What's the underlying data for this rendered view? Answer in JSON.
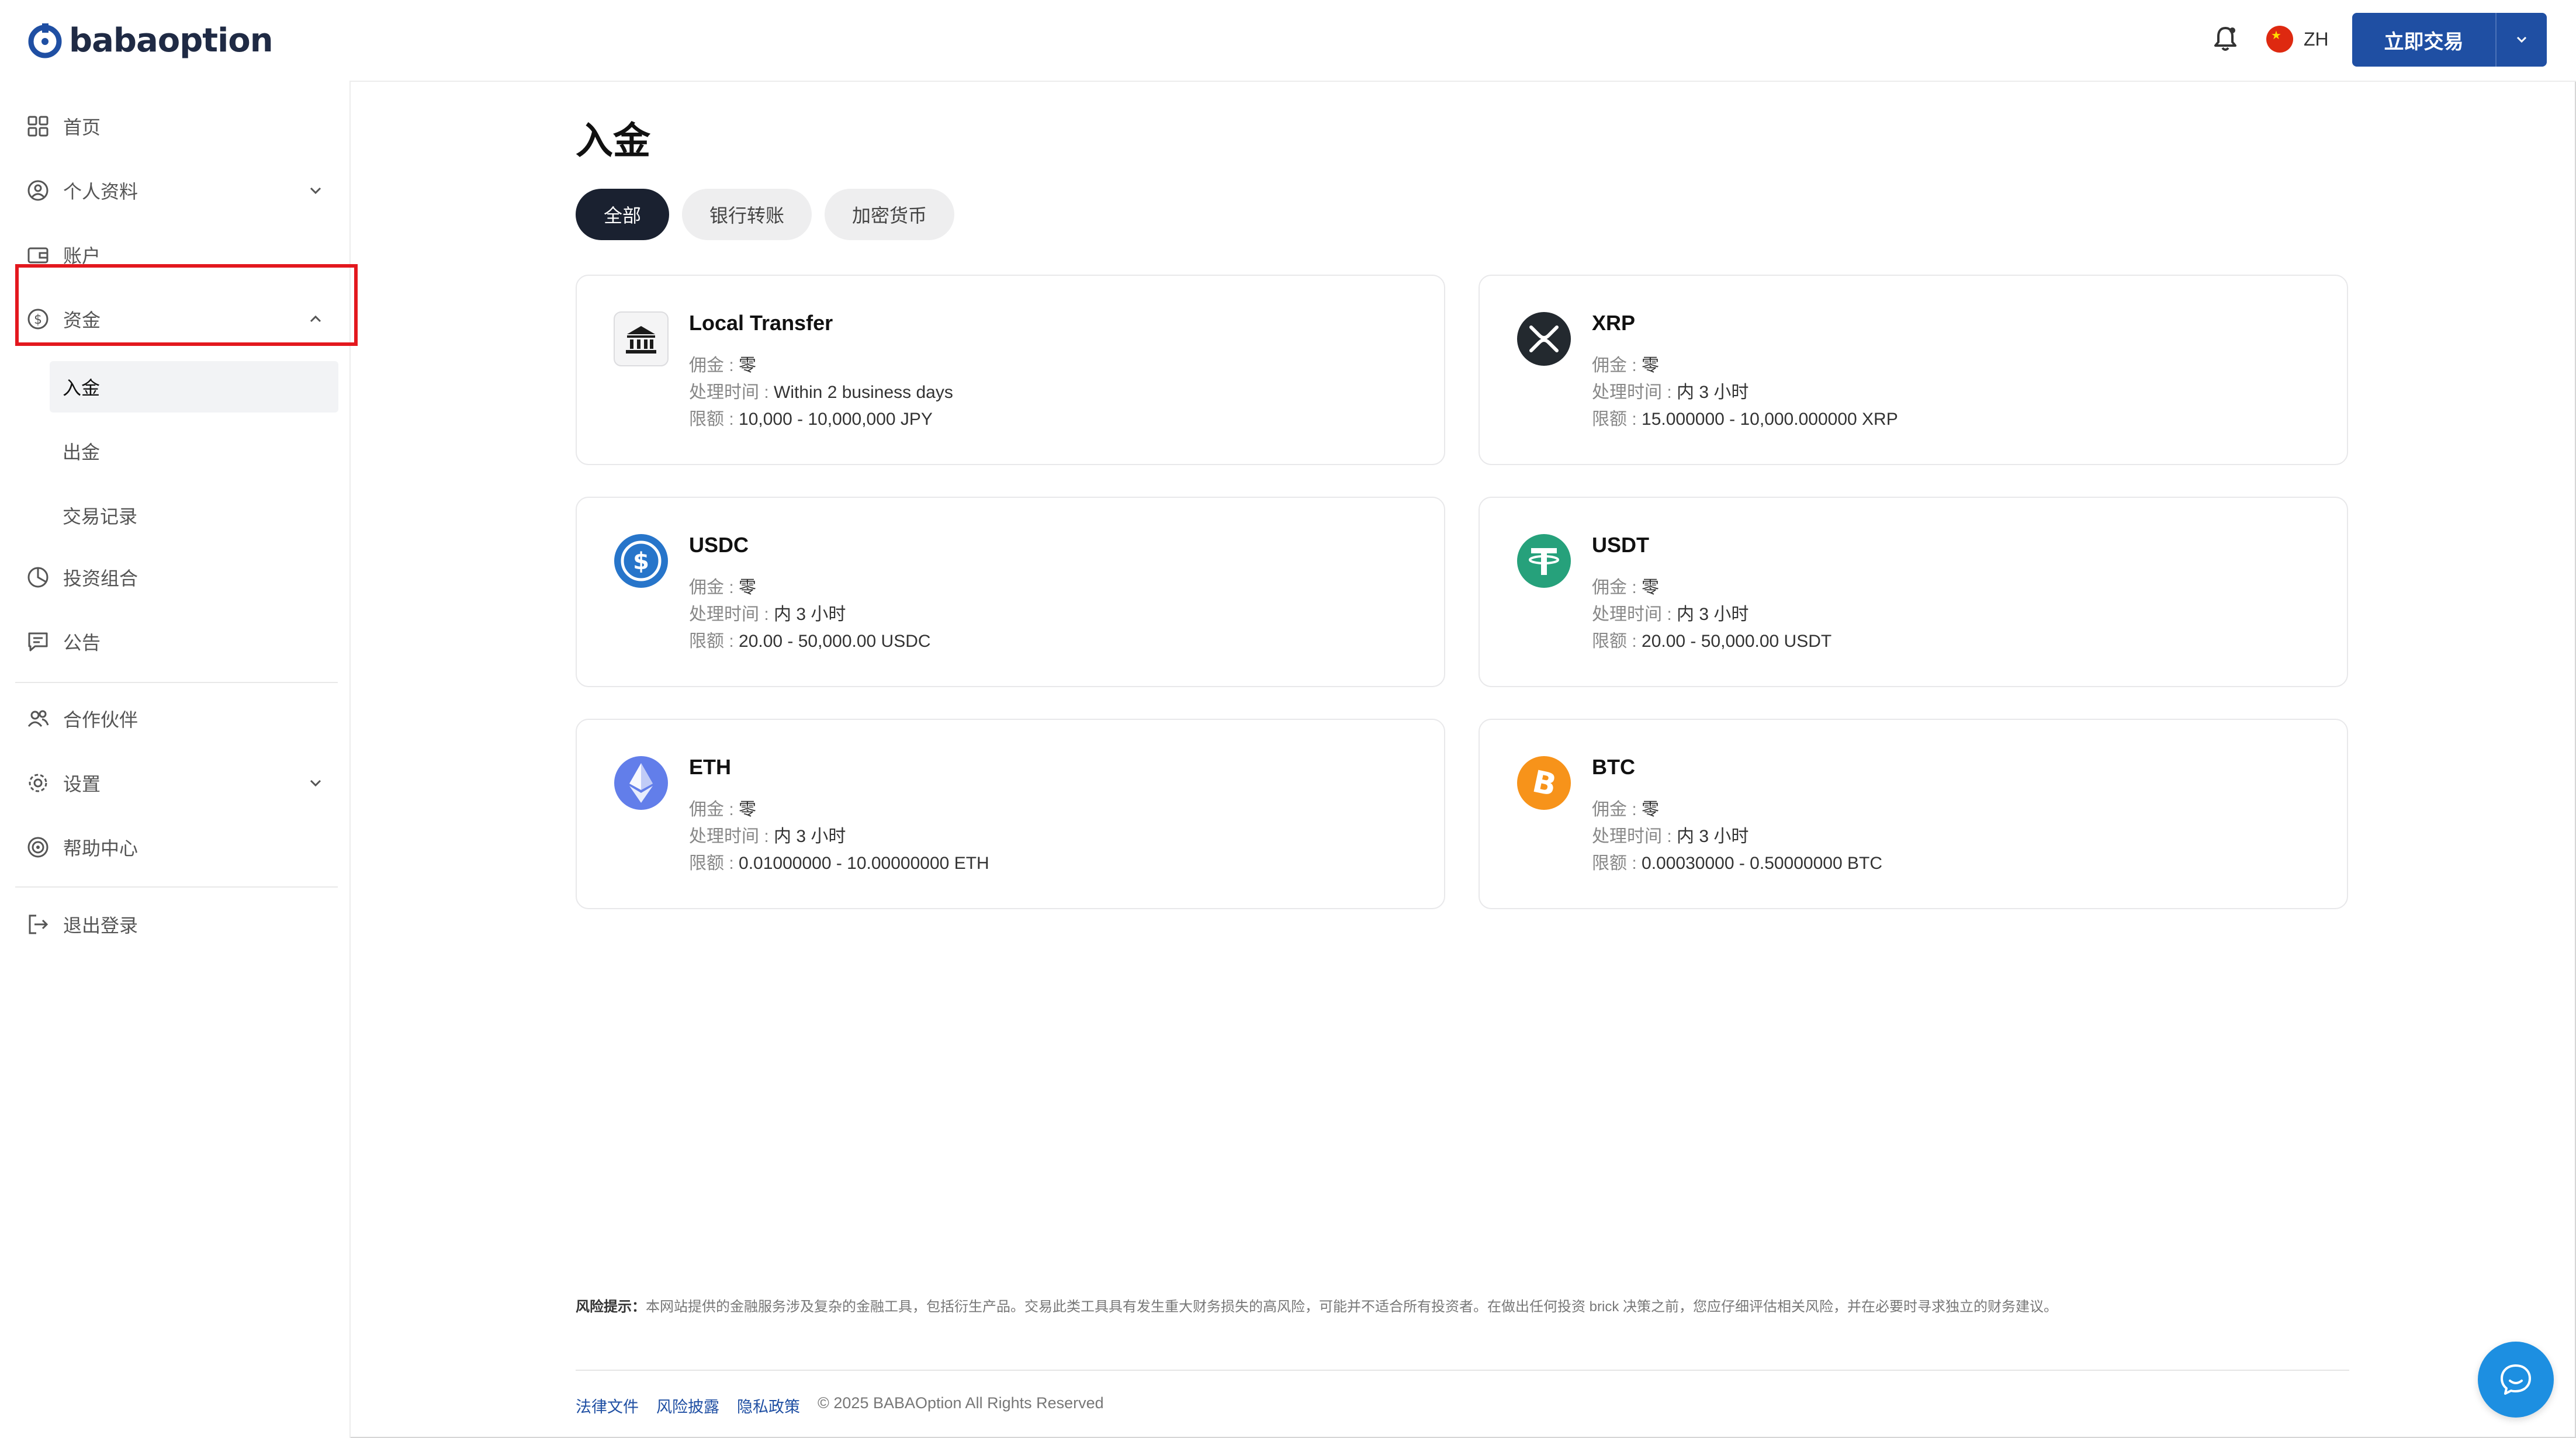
{
  "header": {
    "logo_text": "babaoption",
    "language": "ZH",
    "trade_button": "立即交易"
  },
  "sidebar": {
    "items": [
      {
        "label": "首页",
        "icon": "grid-icon"
      },
      {
        "label": "个人资料",
        "icon": "user-circle-icon"
      },
      {
        "label": "账户",
        "icon": "wallet-icon"
      },
      {
        "label": "资金",
        "icon": "dollar-circle-icon"
      },
      {
        "label": "投资组合",
        "icon": "pie-chart-icon"
      },
      {
        "label": "公告",
        "icon": "message-icon"
      },
      {
        "label": "合作伙伴",
        "icon": "users-icon"
      },
      {
        "label": "设置",
        "icon": "gear-icon"
      },
      {
        "label": "帮助中心",
        "icon": "help-icon"
      },
      {
        "label": "退出登录",
        "icon": "logout-icon"
      }
    ],
    "funds_sub": [
      "入金",
      "出金",
      "交易记录"
    ]
  },
  "main": {
    "title": "入金",
    "tabs": [
      "全部",
      "银行转账",
      "加密货币"
    ],
    "labels": {
      "fee": "佣金 :",
      "time": "处理时间 :",
      "limit": "限额 :"
    },
    "cards": [
      {
        "name": "Local Transfer",
        "fee": "零",
        "time": "Within 2 business days",
        "limit": "10,000 - 10,000,000 JPY",
        "icon": "bank-icon"
      },
      {
        "name": "XRP",
        "fee": "零",
        "time": "内 3 小时",
        "limit": "15.000000 - 10,000.000000 XRP",
        "icon": "xrp-icon"
      },
      {
        "name": "USDC",
        "fee": "零",
        "time": "内 3 小时",
        "limit": "20.00 - 50,000.00 USDC",
        "icon": "usdc-icon"
      },
      {
        "name": "USDT",
        "fee": "零",
        "time": "内 3 小时",
        "limit": "20.00 - 50,000.00 USDT",
        "icon": "usdt-icon"
      },
      {
        "name": "ETH",
        "fee": "零",
        "time": "内 3 小时",
        "limit": "0.01000000 - 10.00000000 ETH",
        "icon": "eth-icon"
      },
      {
        "name": "BTC",
        "fee": "零",
        "time": "内 3 小时",
        "limit": "0.00030000 - 0.50000000 BTC",
        "icon": "btc-icon"
      }
    ]
  },
  "footer": {
    "risk_label": "风险提示：",
    "risk_text": "本网站提供的金融服务涉及复杂的金融工具，包括衍生产品。交易此类工具具有发生重大财务损失的高风险，可能并不适合所有投资者。在做出任何投资 brick 决策之前，您应仔细评估相关风险，并在必要时寻求独立的财务建议。",
    "links": [
      "法律文件",
      "风险披露",
      "隐私政策"
    ],
    "copyright": "© 2025 BABAOption All Rights Reserved"
  },
  "colors": {
    "brand": "#1f4fa3",
    "tab_active": "#1a2130",
    "highlight": "#e3181e",
    "chat": "#1d8fe1"
  }
}
